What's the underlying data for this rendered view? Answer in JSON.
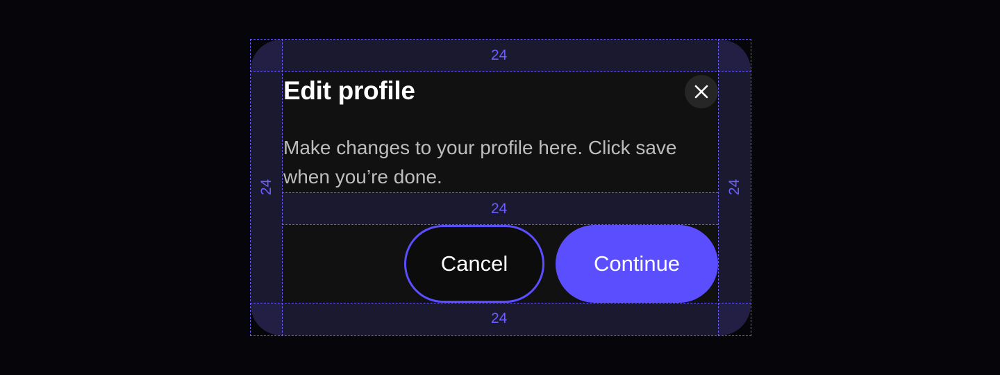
{
  "dialog": {
    "title": "Edit profile",
    "description": "Make changes to your profile here. Click save when you’re done.",
    "close_icon": "close-icon",
    "buttons": {
      "cancel_label": "Cancel",
      "continue_label": "Continue"
    }
  },
  "annotations": {
    "padding_top": "24",
    "padding_bottom": "24",
    "padding_left": "24",
    "padding_right": "24",
    "gap": "24"
  },
  "colors": {
    "background": "#06060a",
    "dialog_surface": "#111111",
    "accent": "#5b4eff",
    "guide": "#6a5cff",
    "title_text": "#ffffff",
    "description_text": "#bdbdbd"
  }
}
